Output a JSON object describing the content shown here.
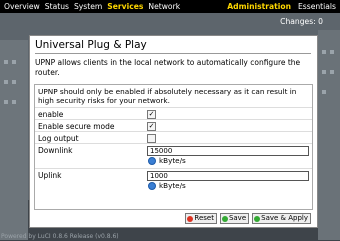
{
  "nav": {
    "items": [
      "Overview",
      "Status",
      "System",
      "Services",
      "Network"
    ],
    "active": "Services",
    "right_items": [
      "Administration",
      "Essentials"
    ]
  },
  "changes": "Changes: 0",
  "page": {
    "title": "Universal Plug & Play",
    "intro": "UPNP allows clients in the local network to automatically configure the router."
  },
  "form": {
    "warning": "UPNP should only be enabled if absolutely necessary as it can result in high security risks for your network.",
    "enable_label": "enable",
    "enable_checked": "✓",
    "secure_label": "Enable secure mode",
    "secure_checked": "✓",
    "log_label": "Log output",
    "downlink_label": "Downlink",
    "downlink_value": "15000",
    "downlink_unit": "kByte/s",
    "uplink_label": "Uplink",
    "uplink_value": "1000",
    "uplink_unit": "kByte/s"
  },
  "buttons": {
    "reset": "Reset",
    "save": "Save",
    "save_apply": "Save & Apply"
  },
  "footer": "Powered by LuCI 0.8.6 Release (v0.8.6)",
  "colors": {
    "active_nav": "#ffd800",
    "topbar": "#000000"
  }
}
